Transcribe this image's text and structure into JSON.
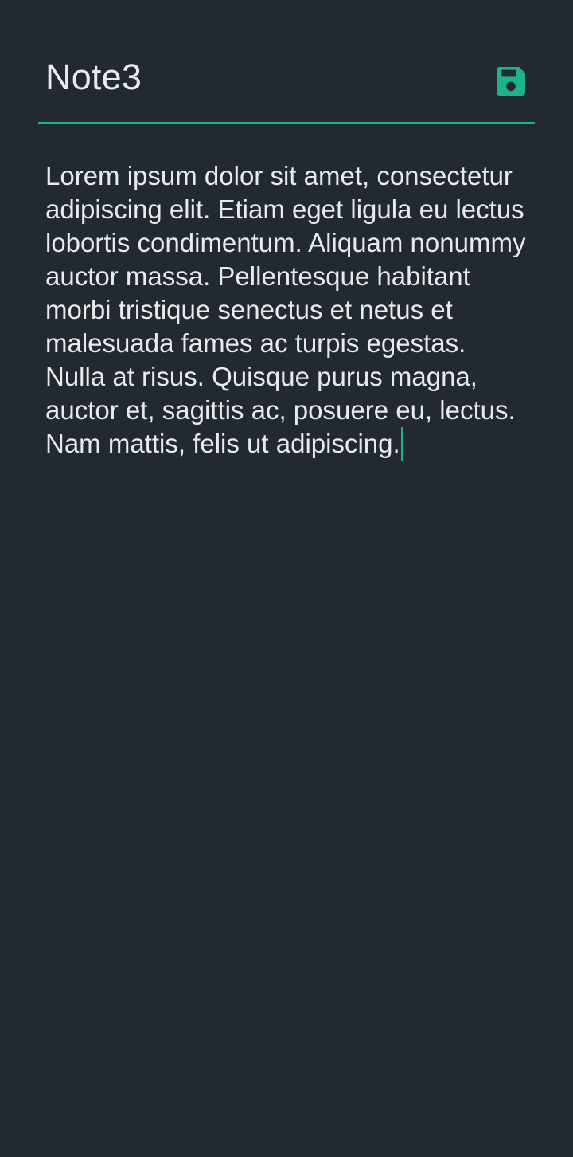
{
  "note": {
    "title": "Note3",
    "body": "Lorem ipsum dolor sit amet, consectetur adipiscing elit. Etiam eget ligula eu lectus lobortis condimentum. Aliquam nonummy auctor massa. Pellentesque habitant morbi tristique senectus et netus et malesuada fames ac turpis egestas. Nulla at risus. Quisque purus magna, auctor et, sagittis ac, posuere eu, lectus. Nam mattis, felis ut adipiscing."
  },
  "toolbar": {
    "save_icon": "floppy-disk-icon"
  },
  "colors": {
    "background": "#222931",
    "accent": "#1db388",
    "text": "#e8eaec"
  }
}
